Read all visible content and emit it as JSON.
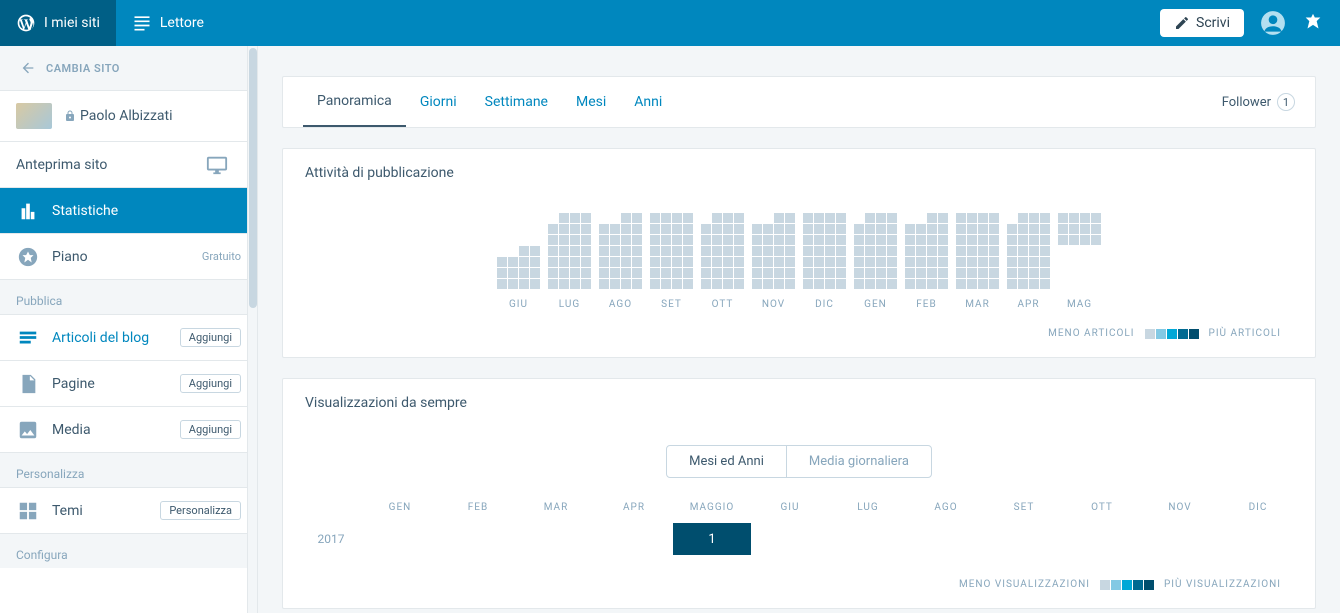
{
  "topbar": {
    "my_sites": "I miei siti",
    "reader": "Lettore",
    "write": "Scrivi"
  },
  "sidebar": {
    "back": "CAMBIA SITO",
    "site_name": "Paolo Albizzati",
    "preview": "Anteprima sito",
    "stats": "Statistiche",
    "plan": "Piano",
    "plan_meta": "Gratuito",
    "section_publish": "Pubblica",
    "posts": "Articoli del blog",
    "posts_btn": "Aggiungi",
    "pages": "Pagine",
    "pages_btn": "Aggiungi",
    "media": "Media",
    "media_btn": "Aggiungi",
    "section_customize": "Personalizza",
    "themes": "Temi",
    "themes_btn": "Personalizza",
    "section_configure": "Configura"
  },
  "tabs": {
    "overview": "Panoramica",
    "days": "Giorni",
    "weeks": "Settimane",
    "months": "Mesi",
    "years": "Anni",
    "follower_label": "Follower",
    "follower_count": "1"
  },
  "activity": {
    "title": "Attività di pubblicazione",
    "months": [
      "GIU",
      "LUG",
      "AGO",
      "SET",
      "OTT",
      "NOV",
      "DIC",
      "GEN",
      "FEB",
      "MAR",
      "APR",
      "MAG"
    ],
    "legend_less": "MENO ARTICOLI",
    "legend_more": "PIÙ ARTICOLI",
    "legend_colors": [
      "#c8d7e1",
      "#83c9e4",
      "#00a8d7",
      "#006a92",
      "#004e6e"
    ]
  },
  "views": {
    "title": "Visualizzazioni da sempre",
    "toggle_a": "Mesi ed Anni",
    "toggle_b": "Media giornaliera",
    "months": [
      "GEN",
      "FEB",
      "MAR",
      "APR",
      "MAGGIO",
      "GIU",
      "LUG",
      "AGO",
      "SET",
      "OTT",
      "NOV",
      "DIC"
    ],
    "year": "2017",
    "value_label": "1",
    "legend_less": "MENO VISUALIZZAZIONI",
    "legend_more": "PIÙ VISUALIZZAZIONI",
    "legend_colors": [
      "#c8d7e1",
      "#83c9e4",
      "#00a8d7",
      "#006a92",
      "#004e6e"
    ]
  },
  "chart_data": {
    "type": "table",
    "title": "Visualizzazioni da sempre — Mesi ed Anni",
    "rows": [
      {
        "year": 2017,
        "values": {
          "GEN": null,
          "FEB": null,
          "MAR": null,
          "APR": null,
          "MAGGIO": 1,
          "GIU": null,
          "LUG": null,
          "AGO": null,
          "SET": null,
          "OTT": null,
          "NOV": null,
          "DIC": null
        }
      }
    ]
  }
}
